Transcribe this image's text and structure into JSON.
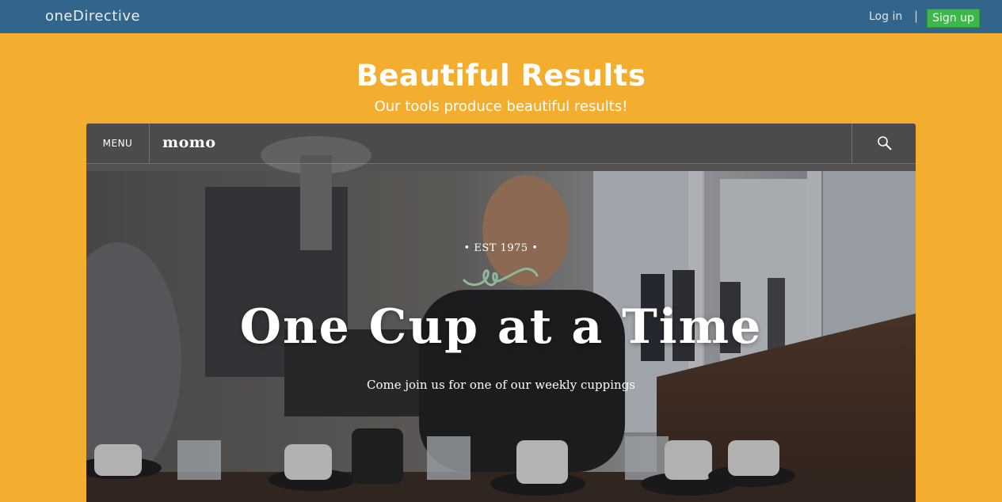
{
  "header": {
    "brand": "oneDirective",
    "login_label": "Log in",
    "divider": "|",
    "signup_label": "Sign up"
  },
  "hero": {
    "title": "Beautiful Results",
    "subtitle": "Our tools produce beautiful results!"
  },
  "preview": {
    "menu_label": "MENU",
    "logo": "momo",
    "search_icon": "search-icon",
    "est_label": "• EST 1975 •",
    "heading": "One Cup at a Time",
    "tagline": "Come join us for one of our weekly cuppings"
  },
  "colors": {
    "page_background": "#f4ae2f",
    "topbar": "#33658b",
    "signup_button": "#3db64b",
    "flourish": "#8fb89a"
  }
}
